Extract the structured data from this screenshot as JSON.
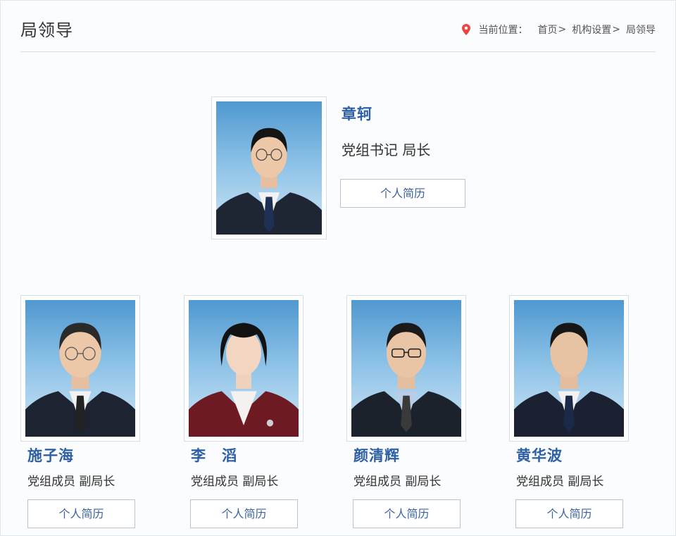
{
  "header": {
    "title": "局领导",
    "location_label": "当前位置：",
    "crumbs": [
      "首页",
      "机构设置",
      "局领导"
    ],
    "separator": ">"
  },
  "leaders": [
    {
      "name": "章轲",
      "title": "党组书记 局长",
      "button": "个人简历"
    },
    {
      "name": "施子海",
      "title": "党组成员 副局长",
      "button": "个人简历"
    },
    {
      "name": "李　滔",
      "title": "党组成员 副局长",
      "button": "个人简历"
    },
    {
      "name": "颜清辉",
      "title": "党组成员 副局长",
      "button": "个人简历"
    },
    {
      "name": "黄华波",
      "title": "党组成员 副局长",
      "button": "个人简历"
    }
  ],
  "colors": {
    "name": "#2d5fa6",
    "button_text": "#3c63a0",
    "pin": "#e9473f",
    "photo_bg": "#6faedc"
  }
}
